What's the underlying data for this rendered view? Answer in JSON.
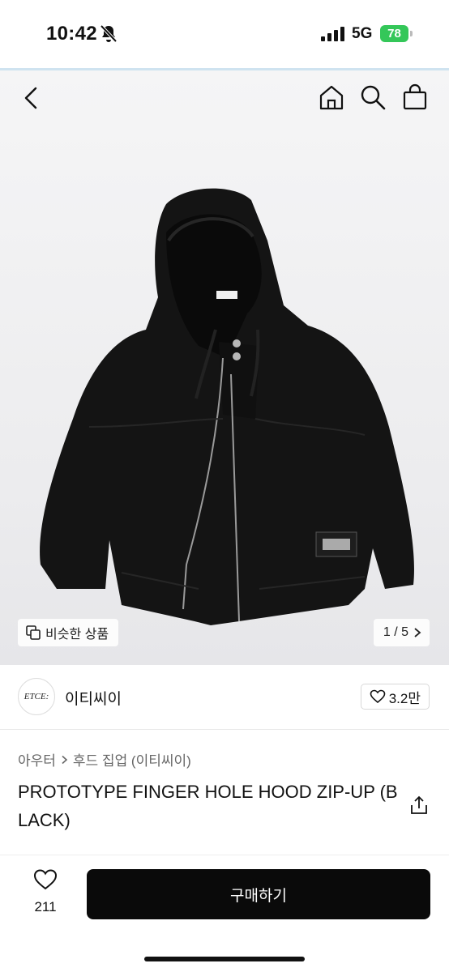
{
  "status_bar": {
    "time": "10:42",
    "network": "5G",
    "battery": "78",
    "icons": [
      "bell-slash-icon",
      "cellular-signal-icon",
      "battery-icon"
    ]
  },
  "nav": {
    "icons": [
      "back-chevron-icon",
      "home-icon",
      "search-icon",
      "shopping-bag-icon"
    ]
  },
  "hero": {
    "image_subject": "black hooded zip-up jacket",
    "similar_label": "비슷한 상품",
    "pager": "1 / 5"
  },
  "store": {
    "logo_text": "ETCE:",
    "name": "이티씨이",
    "likes": "3.2만"
  },
  "product": {
    "breadcrumb": [
      "아우터",
      "후드 집업 (이티씨이)"
    ],
    "title": "PROTOTYPE FINGER HOLE HOOD ZIP-UP (BLACK)"
  },
  "bottom_bar": {
    "wish_count": "211",
    "buy_label": "구매하기"
  },
  "colors": {
    "accent_line": "#cfe3f0",
    "battery": "#34c759",
    "buy_button": "#0a0a0a"
  }
}
